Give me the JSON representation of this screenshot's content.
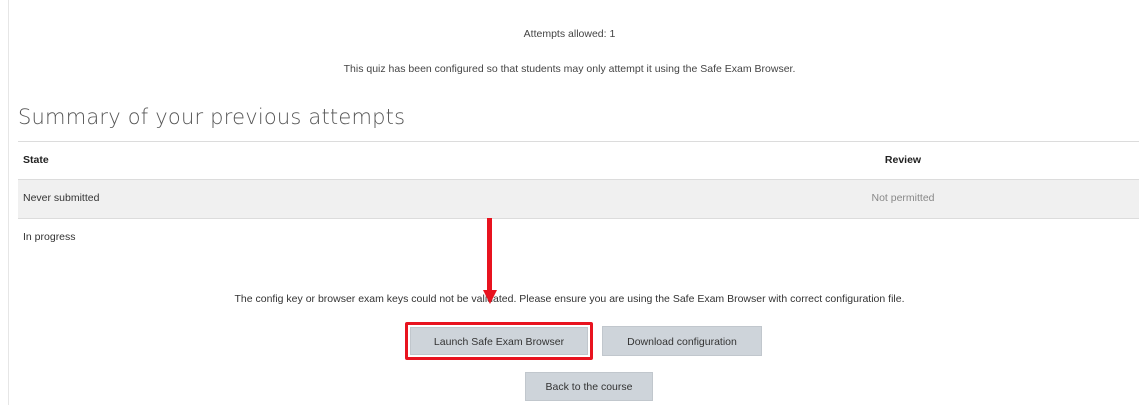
{
  "quiz": {
    "attempts_allowed": "Attempts allowed: 1",
    "seb_note": "This quiz has been configured so that students may only attempt it using the Safe Exam Browser."
  },
  "summary": {
    "title": "Summary of your previous attempts",
    "columns": {
      "state": "State",
      "review": "Review"
    },
    "rows": [
      {
        "state": "Never submitted",
        "review": "Not permitted"
      },
      {
        "state": "In progress",
        "review": ""
      }
    ]
  },
  "warning": "The config key or browser exam keys could not be validated. Please ensure you are using the Safe Exam Browser with correct configuration file.",
  "buttons": {
    "launch": "Launch Safe Exam Browser",
    "download": "Download configuration",
    "back": "Back to the course"
  },
  "colors": {
    "annotation": "#e8131f",
    "button_bg": "#ced4da",
    "row_shade": "#f0f0f0"
  }
}
